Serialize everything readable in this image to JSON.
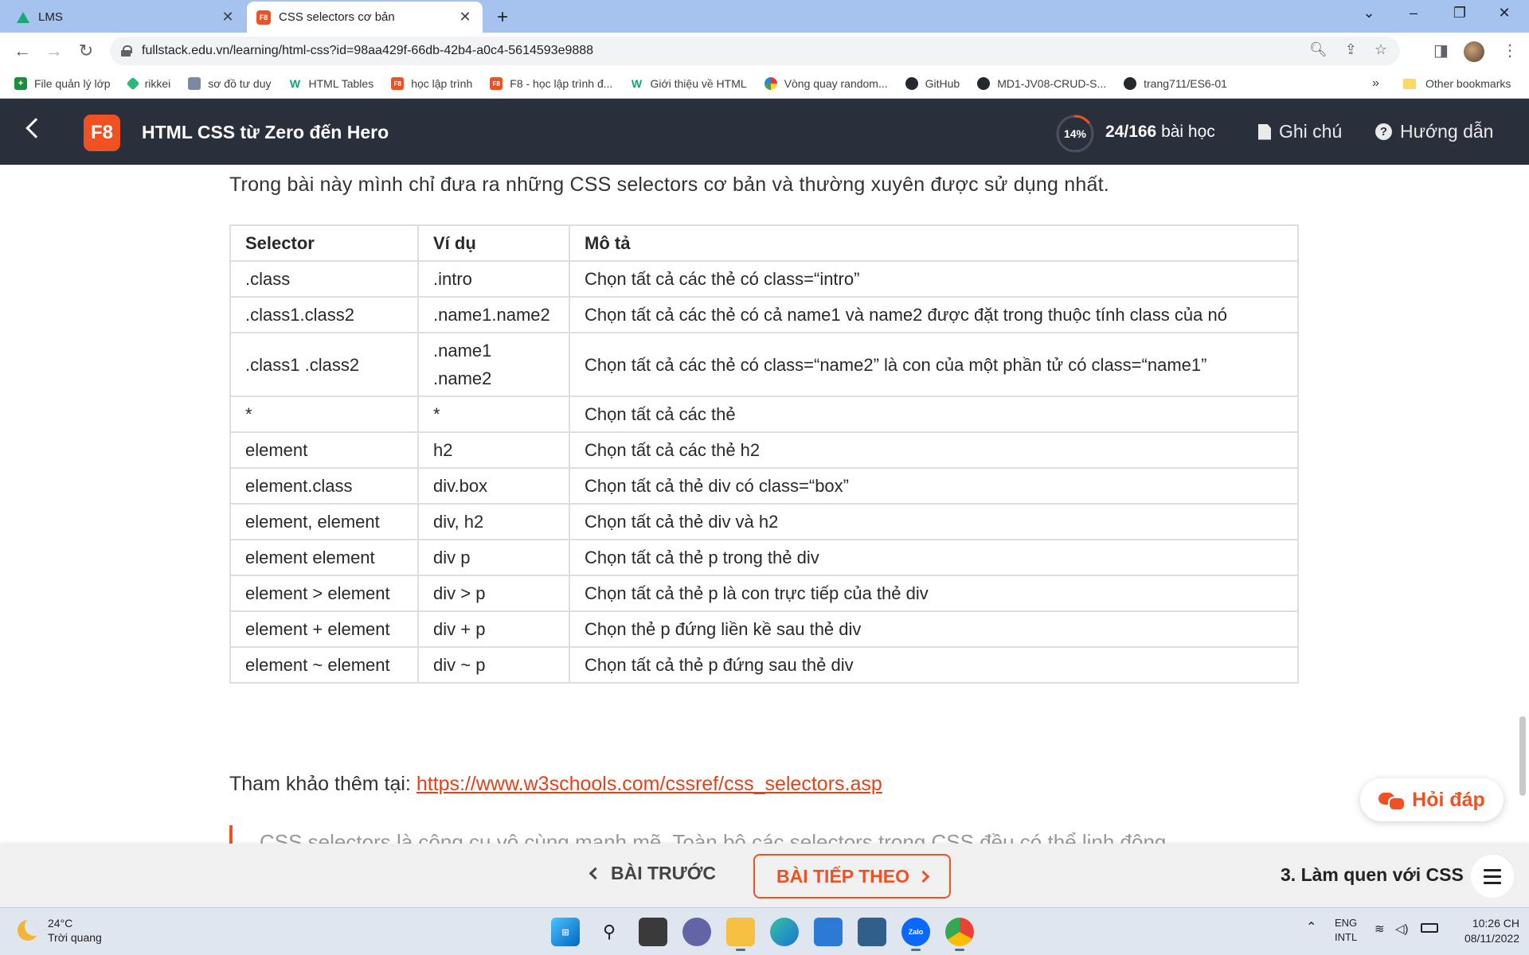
{
  "browser": {
    "tabs": [
      {
        "title": "LMS",
        "active": false
      },
      {
        "title": "CSS selectors cơ bản",
        "active": true
      }
    ],
    "url": "fullstack.edu.vn/learning/html-css?id=98aa429f-66db-42b4-a0c4-5614593e9888",
    "bookmarks": [
      {
        "label": "File quản lý lớp",
        "icon": "sheets-icon"
      },
      {
        "label": "rikkei",
        "icon": "rikkei-icon"
      },
      {
        "label": "sơ đồ tư duy",
        "icon": "mindmap-icon"
      },
      {
        "label": "HTML Tables",
        "icon": "w3schools-icon"
      },
      {
        "label": "học lập trình",
        "icon": "f8-icon"
      },
      {
        "label": "F8 - học lập trình đ...",
        "icon": "f8-icon"
      },
      {
        "label": "Giới thiệu về HTML",
        "icon": "w3schools-icon"
      },
      {
        "label": "Vòng quay random...",
        "icon": "wheel-icon"
      },
      {
        "label": "GitHub",
        "icon": "github-icon"
      },
      {
        "label": "MD1-JV08-CRUD-S...",
        "icon": "github-icon"
      },
      {
        "label": "trang711/ES6-01",
        "icon": "github-icon"
      }
    ],
    "bookmarks_more": "»",
    "other_bookmarks": "Other bookmarks"
  },
  "header": {
    "logo": "F8",
    "course_title": "HTML CSS từ Zero đến Hero",
    "progress_percent": 14,
    "progress_label": "14%",
    "lessons_count": "24/166",
    "lessons_suffix": "bài học",
    "notes_label": "Ghi chú",
    "guide_label": "Hướng dẫn",
    "accent": "#f05123"
  },
  "content": {
    "intro": "Trong bài này mình chỉ đưa ra những CSS selectors cơ bản và thường xuyên được sử dụng nhất.",
    "table": {
      "headers": [
        "Selector",
        "Ví dụ",
        "Mô tả"
      ],
      "rows": [
        [
          ".class",
          ".intro",
          "Chọn tất cả các thẻ có class=“intro”"
        ],
        [
          ".class1.class2",
          ".name1.name2",
          "Chọn tất cả các thẻ có cả name1 và name2 được đặt trong thuộc tính class của nó"
        ],
        [
          ".class1 .class2",
          ".name1 .name2",
          "Chọn tất cả các thẻ có class=“name2” là con của một phần tử có class=“name1”"
        ],
        [
          "*",
          "*",
          "Chọn tất cả các thẻ"
        ],
        [
          "element",
          "h2",
          "Chọn tất cả các thẻ h2"
        ],
        [
          "element.class",
          "div.box",
          "Chọn tất cả thẻ div có class=“box”"
        ],
        [
          "element, element",
          "div, h2",
          "Chọn tất cả thẻ div và h2"
        ],
        [
          "element element",
          "div p",
          "Chọn tất cả thẻ p trong thẻ div"
        ],
        [
          "element > element",
          "div > p",
          "Chọn tất cả thẻ p là con trực tiếp của thẻ div"
        ],
        [
          "element + element",
          "div + p",
          "Chọn thẻ p đứng liền kề sau thẻ div"
        ],
        [
          "element ~ element",
          "div ~ p",
          "Chọn tất cả thẻ p đứng sau thẻ div"
        ]
      ]
    },
    "reference_prefix": "Tham khảo thêm tại:",
    "reference_link": "https://www.w3schools.com/cssref/css_selectors.asp",
    "quote_text": "CSS selectors là công cụ vô cùng mạnh mẽ. Toàn bộ các selectors trong CSS đều có thể linh động"
  },
  "help_button": "Hỏi đáp",
  "footer": {
    "prev_label": "BÀI TRƯỚC",
    "next_label": "BÀI TIẾP THEO",
    "chapter": "3. Làm quen với CSS"
  },
  "taskbar": {
    "temperature": "24°C",
    "weather": "Trời quang",
    "lang_line1": "ENG",
    "lang_line2": "INTL",
    "time": "10:26 CH",
    "date": "08/11/2022"
  }
}
